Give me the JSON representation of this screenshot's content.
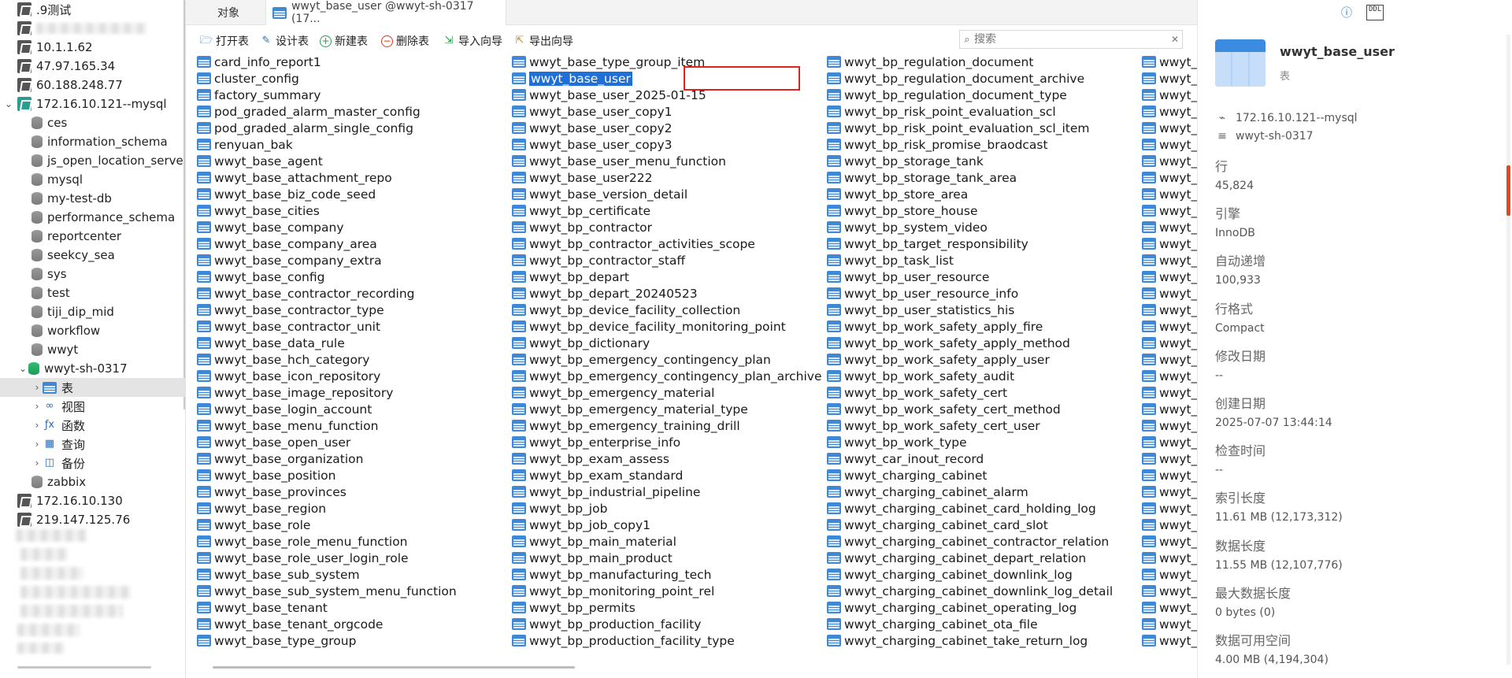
{
  "sidebar": {
    "connections": [
      {
        "label": ".9测试",
        "type": "server"
      },
      {
        "label": "",
        "type": "server",
        "blurred": true
      },
      {
        "label": "10.1.1.62",
        "type": "server"
      },
      {
        "label": "47.97.165.34",
        "type": "server"
      },
      {
        "label": "60.188.248.77",
        "type": "server"
      },
      {
        "label": "172.16.10.121--mysql",
        "type": "mysql"
      }
    ],
    "databases": [
      "ces",
      "information_schema",
      "js_open_location_serve",
      "mysql",
      "my-test-db",
      "performance_schema",
      "reportcenter",
      "seekcy_sea",
      "sys",
      "test",
      "tiji_dip_mid",
      "workflow",
      "wwyt",
      "wwyt-sh-0317"
    ],
    "children": [
      {
        "label": "表",
        "icon": "table-icon"
      },
      {
        "label": "视图",
        "icon": "view-icon"
      },
      {
        "label": "函数",
        "icon": "function-icon"
      },
      {
        "label": "查询",
        "icon": "query-icon"
      },
      {
        "label": "备份",
        "icon": "backup-icon"
      }
    ],
    "after_db": "zabbix",
    "more_connections": [
      "172.16.10.130",
      "219.147.125.76"
    ]
  },
  "tabs": {
    "objects": "对象",
    "table_tab": "wwyt_base_user @wwyt-sh-0317 (17..."
  },
  "toolbar": {
    "open": "打开表",
    "design": "设计表",
    "new": "新建表",
    "delete": "删除表",
    "import": "导入向导",
    "export": "导出向导"
  },
  "search": {
    "placeholder": "搜索"
  },
  "tables": {
    "col1": [
      "card_info_report1",
      "cluster_config",
      "factory_summary",
      "pod_graded_alarm_master_config",
      "pod_graded_alarm_single_config",
      "renyuan_bak",
      "wwyt_base_agent",
      "wwyt_base_attachment_repo",
      "wwyt_base_biz_code_seed",
      "wwyt_base_cities",
      "wwyt_base_company",
      "wwyt_base_company_area",
      "wwyt_base_company_extra",
      "wwyt_base_config",
      "wwyt_base_contractor_recording",
      "wwyt_base_contractor_type",
      "wwyt_base_contractor_unit",
      "wwyt_base_data_rule",
      "wwyt_base_hch_category",
      "wwyt_base_icon_repository",
      "wwyt_base_image_repository",
      "wwyt_base_login_account",
      "wwyt_base_menu_function",
      "wwyt_base_open_user",
      "wwyt_base_organization",
      "wwyt_base_position",
      "wwyt_base_provinces",
      "wwyt_base_region",
      "wwyt_base_role",
      "wwyt_base_role_menu_function",
      "wwyt_base_role_user_login_role",
      "wwyt_base_sub_system",
      "wwyt_base_sub_system_menu_function",
      "wwyt_base_tenant",
      "wwyt_base_tenant_orgcode",
      "wwyt_base_type_group"
    ],
    "col2": [
      "wwyt_base_type_group_item",
      "wwyt_base_user",
      "wwyt_base_user_2025-01-15",
      "wwyt_base_user_copy1",
      "wwyt_base_user_copy2",
      "wwyt_base_user_copy3",
      "wwyt_base_user_menu_function",
      "wwyt_base_user222",
      "wwyt_base_version_detail",
      "wwyt_bp_certificate",
      "wwyt_bp_contractor",
      "wwyt_bp_contractor_activities_scope",
      "wwyt_bp_contractor_staff",
      "wwyt_bp_depart",
      "wwyt_bp_depart_20240523",
      "wwyt_bp_device_facility_collection",
      "wwyt_bp_device_facility_monitoring_point",
      "wwyt_bp_dictionary",
      "wwyt_bp_emergency_contingency_plan",
      "wwyt_bp_emergency_contingency_plan_archive",
      "wwyt_bp_emergency_material",
      "wwyt_bp_emergency_material_type",
      "wwyt_bp_emergency_training_drill",
      "wwyt_bp_enterprise_info",
      "wwyt_bp_exam_assess",
      "wwyt_bp_exam_standard",
      "wwyt_bp_industrial_pipeline",
      "wwyt_bp_job",
      "wwyt_bp_job_copy1",
      "wwyt_bp_main_material",
      "wwyt_bp_main_product",
      "wwyt_bp_manufacturing_tech",
      "wwyt_bp_monitoring_point_rel",
      "wwyt_bp_permits",
      "wwyt_bp_production_facility",
      "wwyt_bp_production_facility_type"
    ],
    "col3": [
      "wwyt_bp_regulation_document",
      "wwyt_bp_regulation_document_archive",
      "wwyt_bp_regulation_document_type",
      "wwyt_bp_risk_point_evaluation_scl",
      "wwyt_bp_risk_point_evaluation_scl_item",
      "wwyt_bp_risk_promise_braodcast",
      "wwyt_bp_storage_tank",
      "wwyt_bp_storage_tank_area",
      "wwyt_bp_store_area",
      "wwyt_bp_store_house",
      "wwyt_bp_system_video",
      "wwyt_bp_target_responsibility",
      "wwyt_bp_task_list",
      "wwyt_bp_user_resource",
      "wwyt_bp_user_resource_info",
      "wwyt_bp_user_statistics_his",
      "wwyt_bp_work_safety_apply_fire",
      "wwyt_bp_work_safety_apply_method",
      "wwyt_bp_work_safety_apply_user",
      "wwyt_bp_work_safety_audit",
      "wwyt_bp_work_safety_cert",
      "wwyt_bp_work_safety_cert_method",
      "wwyt_bp_work_safety_cert_user",
      "wwyt_bp_work_type",
      "wwyt_car_inout_record",
      "wwyt_charging_cabinet",
      "wwyt_charging_cabinet_alarm",
      "wwyt_charging_cabinet_card_holding_log",
      "wwyt_charging_cabinet_card_slot",
      "wwyt_charging_cabinet_contractor_relation",
      "wwyt_charging_cabinet_depart_relation",
      "wwyt_charging_cabinet_downlink_log",
      "wwyt_charging_cabinet_downlink_log_detail",
      "wwyt_charging_cabinet_operating_log",
      "wwyt_charging_cabinet_ota_file",
      "wwyt_charging_cabinet_take_return_log"
    ],
    "col4": [
      "wwyt_c",
      "wwyt_c",
      "wwyt_c",
      "wwyt_c",
      "wwyt_c",
      "wwyt_c",
      "wwyt_r",
      "wwyt_r",
      "wwyt_r",
      "wwyt_r",
      "wwyt_r",
      "wwyt_r",
      "wwyt_r",
      "wwyt_r",
      "wwyt_r",
      "wwyt_r",
      "wwyt_r",
      "wwyt_r",
      "wwyt_r",
      "wwyt_r",
      "wwyt_r",
      "wwyt_r",
      "wwyt_p",
      "wwyt_p",
      "wwyt_p",
      "wwyt_p",
      "wwyt_p",
      "wwyt_p",
      "wwyt_p",
      "wwyt_p",
      "wwyt_p",
      "wwyt_p",
      "wwyt_p",
      "wwyt_p",
      "wwyt_p",
      "wwyt_p"
    ],
    "selected": "wwyt_base_user"
  },
  "info": {
    "name": "wwyt_base_user",
    "type": "表",
    "connection": "172.16.10.121--mysql",
    "database": "wwyt-sh-0317",
    "props": [
      {
        "label": "行",
        "value": "45,824"
      },
      {
        "label": "引擎",
        "value": "InnoDB"
      },
      {
        "label": "自动递增",
        "value": "100,933"
      },
      {
        "label": "行格式",
        "value": "Compact"
      },
      {
        "label": "修改日期",
        "value": "--"
      },
      {
        "label": "创建日期",
        "value": "2025-07-07 13:44:14"
      },
      {
        "label": "检查时间",
        "value": "--"
      },
      {
        "label": "索引长度",
        "value": "11.61 MB (12,173,312)"
      },
      {
        "label": "数据长度",
        "value": "11.55 MB (12,107,776)"
      },
      {
        "label": "最大数据长度",
        "value": "0 bytes (0)"
      },
      {
        "label": "数据可用空间",
        "value": "4.00 MB (4,194,304)"
      }
    ]
  },
  "colors": {
    "accent": "#1f6fd6",
    "highlight_box": "#e0241b"
  }
}
